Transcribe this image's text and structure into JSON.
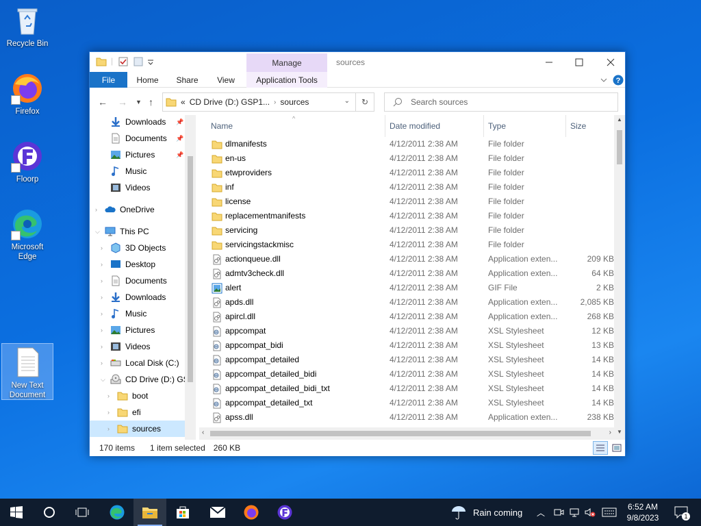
{
  "desktop": {
    "icons": [
      {
        "label": "Recycle Bin"
      },
      {
        "label": "Firefox"
      },
      {
        "label": "Floorp"
      },
      {
        "label": "Microsoft Edge"
      },
      {
        "label": "New Text Document"
      }
    ]
  },
  "window": {
    "title": "sources",
    "manage_label": "Manage",
    "ribbon_tabs": [
      "File",
      "Home",
      "Share",
      "View",
      "Application Tools"
    ],
    "address": {
      "prefix": "«",
      "parts": [
        "CD Drive (D:) GSP1...",
        "sources"
      ]
    },
    "search_placeholder": "Search sources",
    "columns": [
      "Name",
      "Date modified",
      "Type",
      "Size"
    ],
    "nav_items": [
      {
        "label": "Downloads",
        "icon": "downloads-icon",
        "pinned": true
      },
      {
        "label": "Documents",
        "icon": "documents-icon",
        "pinned": true
      },
      {
        "label": "Pictures",
        "icon": "pictures-icon",
        "pinned": true
      },
      {
        "label": "Music",
        "icon": "music-icon",
        "pinned": false
      },
      {
        "label": "Videos",
        "icon": "videos-icon",
        "pinned": false
      },
      {
        "label": "OneDrive",
        "icon": "onedrive-icon",
        "pinned": false
      },
      {
        "label": "This PC",
        "icon": "this-pc-icon",
        "pinned": false
      },
      {
        "label": "3D Objects",
        "icon": "3d-objects-icon",
        "pinned": false
      },
      {
        "label": "Desktop",
        "icon": "desktop-icon",
        "pinned": false
      },
      {
        "label": "Documents",
        "icon": "documents-icon",
        "pinned": false
      },
      {
        "label": "Downloads",
        "icon": "downloads-icon",
        "pinned": false
      },
      {
        "label": "Music",
        "icon": "music-icon",
        "pinned": false
      },
      {
        "label": "Pictures",
        "icon": "pictures-icon",
        "pinned": false
      },
      {
        "label": "Videos",
        "icon": "videos-icon",
        "pinned": false
      },
      {
        "label": "Local Disk (C:)",
        "icon": "local-disk-icon",
        "pinned": false
      },
      {
        "label": "CD Drive (D:) GS",
        "icon": "cd-drive-icon",
        "pinned": false
      },
      {
        "label": "boot",
        "icon": "folder-icon",
        "pinned": false
      },
      {
        "label": "efi",
        "icon": "folder-icon",
        "pinned": false
      },
      {
        "label": "sources",
        "icon": "folder-icon",
        "pinned": false
      }
    ],
    "files": [
      {
        "name": "dlmanifests",
        "date": "4/12/2011 2:38 AM",
        "type": "File folder",
        "size": "",
        "icon": "folder"
      },
      {
        "name": "en-us",
        "date": "4/12/2011 2:38 AM",
        "type": "File folder",
        "size": "",
        "icon": "folder"
      },
      {
        "name": "etwproviders",
        "date": "4/12/2011 2:38 AM",
        "type": "File folder",
        "size": "",
        "icon": "folder"
      },
      {
        "name": "inf",
        "date": "4/12/2011 2:38 AM",
        "type": "File folder",
        "size": "",
        "icon": "folder"
      },
      {
        "name": "license",
        "date": "4/12/2011 2:38 AM",
        "type": "File folder",
        "size": "",
        "icon": "folder"
      },
      {
        "name": "replacementmanifests",
        "date": "4/12/2011 2:38 AM",
        "type": "File folder",
        "size": "",
        "icon": "folder"
      },
      {
        "name": "servicing",
        "date": "4/12/2011 2:38 AM",
        "type": "File folder",
        "size": "",
        "icon": "folder"
      },
      {
        "name": "servicingstackmisc",
        "date": "4/12/2011 2:38 AM",
        "type": "File folder",
        "size": "",
        "icon": "folder"
      },
      {
        "name": "actionqueue.dll",
        "date": "4/12/2011 2:38 AM",
        "type": "Application exten...",
        "size": "209 KB",
        "icon": "dll"
      },
      {
        "name": "admtv3check.dll",
        "date": "4/12/2011 2:38 AM",
        "type": "Application exten...",
        "size": "64 KB",
        "icon": "dll"
      },
      {
        "name": "alert",
        "date": "4/12/2011 2:38 AM",
        "type": "GIF File",
        "size": "2 KB",
        "icon": "gif"
      },
      {
        "name": "apds.dll",
        "date": "4/12/2011 2:38 AM",
        "type": "Application exten...",
        "size": "2,085 KB",
        "icon": "dll"
      },
      {
        "name": "apircl.dll",
        "date": "4/12/2011 2:38 AM",
        "type": "Application exten...",
        "size": "268 KB",
        "icon": "dll"
      },
      {
        "name": "appcompat",
        "date": "4/12/2011 2:38 AM",
        "type": "XSL Stylesheet",
        "size": "12 KB",
        "icon": "xsl"
      },
      {
        "name": "appcompat_bidi",
        "date": "4/12/2011 2:38 AM",
        "type": "XSL Stylesheet",
        "size": "13 KB",
        "icon": "xsl"
      },
      {
        "name": "appcompat_detailed",
        "date": "4/12/2011 2:38 AM",
        "type": "XSL Stylesheet",
        "size": "14 KB",
        "icon": "xsl"
      },
      {
        "name": "appcompat_detailed_bidi",
        "date": "4/12/2011 2:38 AM",
        "type": "XSL Stylesheet",
        "size": "14 KB",
        "icon": "xsl"
      },
      {
        "name": "appcompat_detailed_bidi_txt",
        "date": "4/12/2011 2:38 AM",
        "type": "XSL Stylesheet",
        "size": "14 KB",
        "icon": "xsl"
      },
      {
        "name": "appcompat_detailed_txt",
        "date": "4/12/2011 2:38 AM",
        "type": "XSL Stylesheet",
        "size": "14 KB",
        "icon": "xsl"
      },
      {
        "name": "apss.dll",
        "date": "4/12/2011 2:38 AM",
        "type": "Application exten...",
        "size": "238 KB",
        "icon": "dll"
      }
    ],
    "status": {
      "count": "170 items",
      "selected": "1 item selected",
      "size": "260 KB"
    }
  },
  "taskbar": {
    "weather": "Rain coming",
    "time": "6:52 AM",
    "date": "9/8/2023",
    "notification_count": "1"
  },
  "colors": {
    "accent": "#1a73c8",
    "manage": "#e7d9f7",
    "folder": "#f8d775",
    "taskbar": "#0f1c2e"
  }
}
